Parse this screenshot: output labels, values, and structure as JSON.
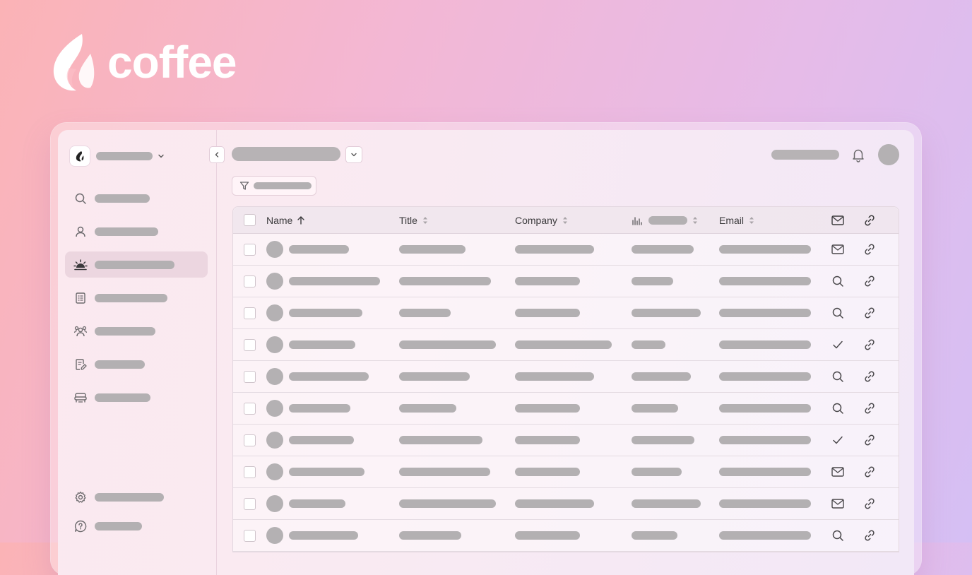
{
  "brand": {
    "name": "coffee"
  },
  "colors": {
    "placeholder": "#b3b0b2",
    "icon": "#6c6a6d",
    "header_text": "#3b3a3c"
  },
  "sidebar": {
    "workspace_icon": "coffee-logo-icon",
    "items": [
      {
        "icon": "search-icon",
        "active": false
      },
      {
        "icon": "person-icon",
        "active": false
      },
      {
        "icon": "sunrise-icon",
        "active": true
      },
      {
        "icon": "list-icon",
        "active": false
      },
      {
        "icon": "team-icon",
        "active": false
      },
      {
        "icon": "notes-icon",
        "active": false
      },
      {
        "icon": "couch-icon",
        "active": false
      }
    ],
    "bottom_items": [
      {
        "icon": "gear-icon"
      },
      {
        "icon": "help-icon"
      }
    ]
  },
  "table": {
    "columns": [
      {
        "label": "Name",
        "sort": "ascending"
      },
      {
        "label": "Title",
        "sort": "none"
      },
      {
        "label": "Company",
        "sort": "none"
      },
      {
        "label": "",
        "icon": "bar-chart-icon",
        "sort": "none"
      },
      {
        "label": "Email",
        "sort": "none"
      }
    ],
    "header_icons": [
      "mail-icon",
      "link-icon"
    ],
    "rows": [
      {
        "action_icon": "mail-icon"
      },
      {
        "action_icon": "search-icon"
      },
      {
        "action_icon": "search-icon"
      },
      {
        "action_icon": "check-icon"
      },
      {
        "action_icon": "search-icon"
      },
      {
        "action_icon": "search-icon"
      },
      {
        "action_icon": "check-icon"
      },
      {
        "action_icon": "mail-icon"
      },
      {
        "action_icon": "mail-icon"
      },
      {
        "action_icon": "search-icon"
      }
    ]
  }
}
